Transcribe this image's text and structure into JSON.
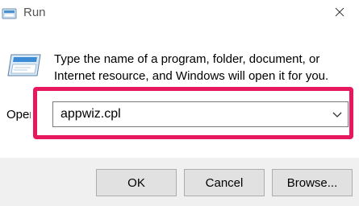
{
  "window": {
    "title": "Run",
    "title_icon": "run-icon",
    "close_icon": "close-icon"
  },
  "content": {
    "description": "Type the name of a program, folder, document, or Internet resource, and Windows will open it for you.",
    "large_icon": "run-icon",
    "open_label": "Open:",
    "open_value": "appwiz.cpl",
    "dropdown_icon": "chevron-down-icon",
    "highlight_color": "#e8185e"
  },
  "buttons": {
    "ok": "OK",
    "cancel": "Cancel",
    "browse": "Browse..."
  }
}
